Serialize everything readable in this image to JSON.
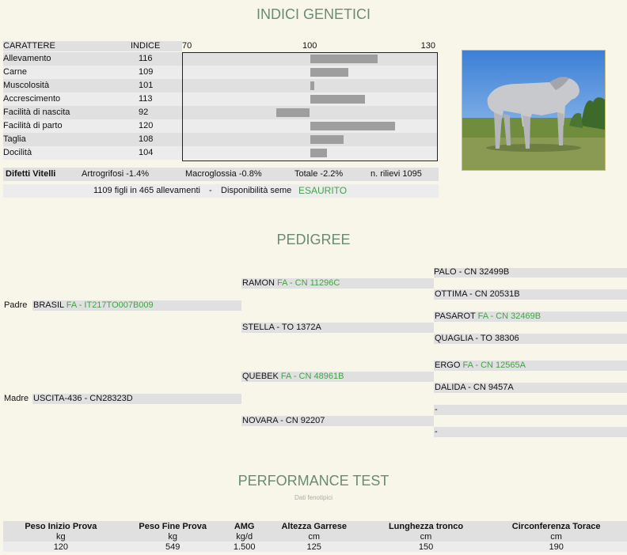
{
  "genetic": {
    "title": "INDICI GENETICI",
    "col_trait": "CARATTERE",
    "col_index": "INDICE",
    "scale": [
      "70",
      "100",
      "130"
    ],
    "scale_min": 70,
    "scale_max": 130,
    "scale_mid": 100,
    "traits": [
      {
        "name": "Allevamento",
        "value": 116
      },
      {
        "name": "Carne",
        "value": 109
      },
      {
        "name": "Muscolosità",
        "value": 101
      },
      {
        "name": "Accrescimento",
        "value": 113
      },
      {
        "name": "Facilità di nascita",
        "value": 92
      },
      {
        "name": "Facilità di parto",
        "value": 120
      },
      {
        "name": "Taglia",
        "value": 108
      },
      {
        "name": "Docilità",
        "value": 104
      }
    ],
    "defects": {
      "label": "Difetti Vitelli",
      "artro": "Artrogrifosi -1.4%",
      "macro": "Macroglossia -0.8%",
      "totale": "Totale -2.2%",
      "rilievi": "n. rilievi 1095"
    },
    "offspring": "1109 figli in 465 allevamenti",
    "sep": "-",
    "availability_label": "Disponibilità seme",
    "availability_value": "ESAURITO"
  },
  "pedigree": {
    "title": "PEDIGREE",
    "father_label": "Padre",
    "father_name": "BRASIL",
    "father_code": "FA - IT217TO007B009",
    "mother_label": "Madre",
    "mother_name": "USCITA-436 - CN28323D",
    "pat_gf_name": "RAMON",
    "pat_gf_code": "FA - CN 11296C",
    "pat_gm": "STELLA - TO 1372A",
    "mat_gf_name": "QUEBEK",
    "mat_gf_code": "FA - CN 48961B",
    "mat_gm": "NOVARA - CN 92207",
    "ggp1": "PALO - CN 32499B",
    "ggp2": "OTTIMA - CN 20531B",
    "ggp3_name": "PASAROT",
    "ggp3_code": "FA - CN 32469B",
    "ggp4": "QUAGLIA - TO 38306",
    "ggp5_name": "ERGO",
    "ggp5_code": "FA - CN 12565A",
    "ggp6": "DALIDA - CN 9457A",
    "ggp7": "-",
    "ggp8": "-"
  },
  "performance": {
    "title": "PERFORMANCE TEST",
    "subtitle": "Dati fenotipici",
    "headers": [
      "Peso Inizio Prova",
      "Peso Fine Prova",
      "AMG",
      "Altezza Garrese",
      "Lunghezza tronco",
      "Circonferenza Torace"
    ],
    "units": [
      "kg",
      "kg",
      "kg/d",
      "cm",
      "cm",
      "cm"
    ],
    "values": [
      "120",
      "549",
      "1.500",
      "125",
      "150",
      "190"
    ]
  },
  "colors": {
    "accent": "#6a8a76",
    "link": "#45a049",
    "bar": "#9e9e9e"
  }
}
